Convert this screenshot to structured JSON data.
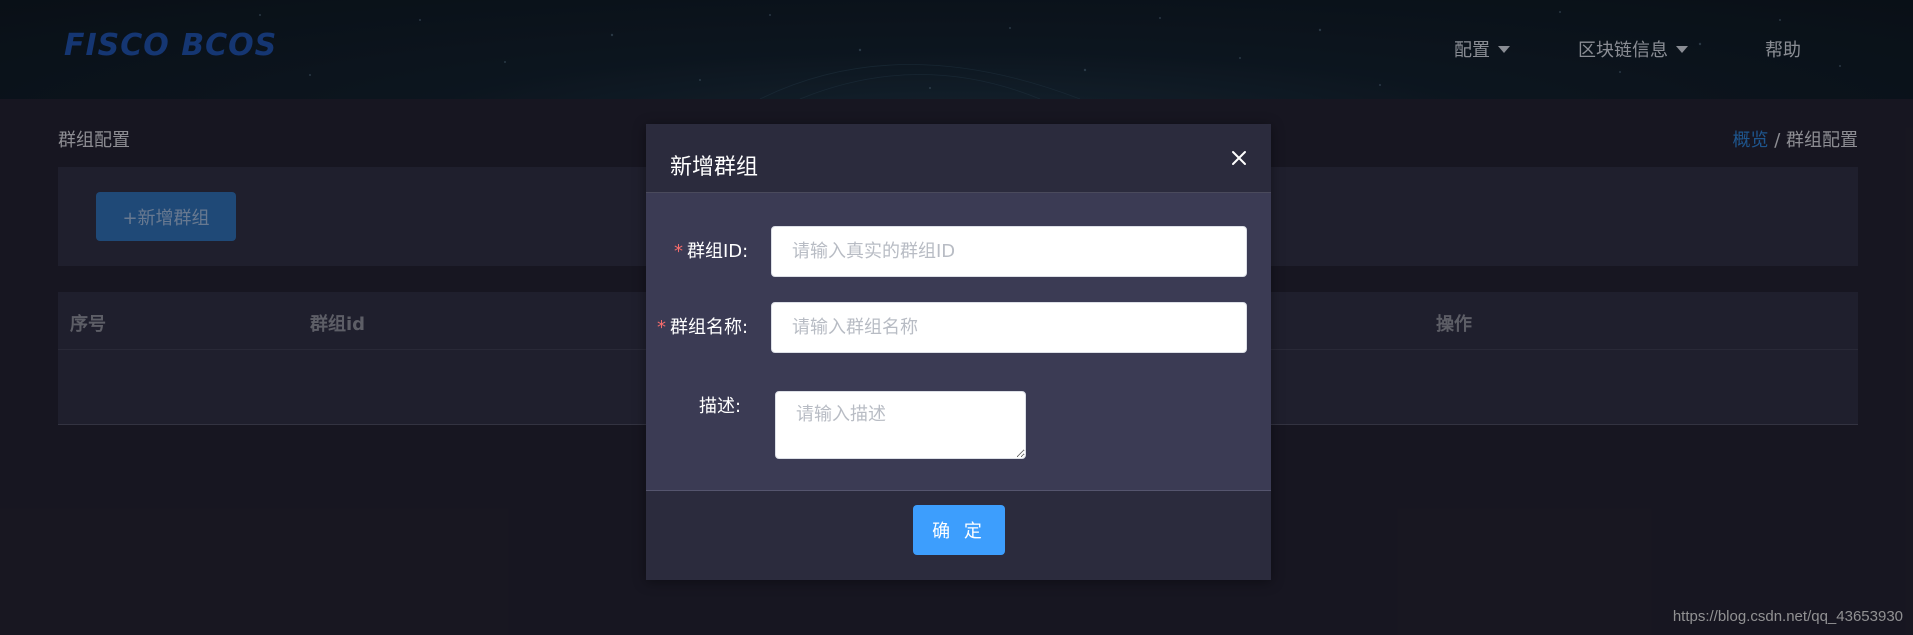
{
  "header": {
    "logo_text": "FISCO BCOS",
    "nav": {
      "config": "配置",
      "chain_info": "区块链信息",
      "help": "帮助"
    }
  },
  "page": {
    "title": "群组配置",
    "breadcrumb": {
      "home": "概览",
      "separator": "/",
      "current": "群组配置"
    },
    "add_group_button": "+新增群组",
    "table": {
      "columns": [
        "序号",
        "群组id",
        "操作"
      ]
    }
  },
  "modal": {
    "title": "新增群组",
    "fields": {
      "group_id_label": "群组ID:",
      "group_id_placeholder": "请输入真实的群组ID",
      "group_id_value": "",
      "group_name_label": "群组名称:",
      "group_name_placeholder": "请输入群组名称",
      "group_name_value": "",
      "description_label": "描述:",
      "description_placeholder": "请输入描述",
      "description_value": ""
    },
    "required_mark": "*",
    "confirm_button": "确 定"
  },
  "watermark": "https://blog.csdn.net/qq_43653930",
  "colors": {
    "accent": "#3d9efd",
    "link": "#2a7ed1",
    "required": "#f56c6c",
    "logo": "#1c4fa8"
  }
}
